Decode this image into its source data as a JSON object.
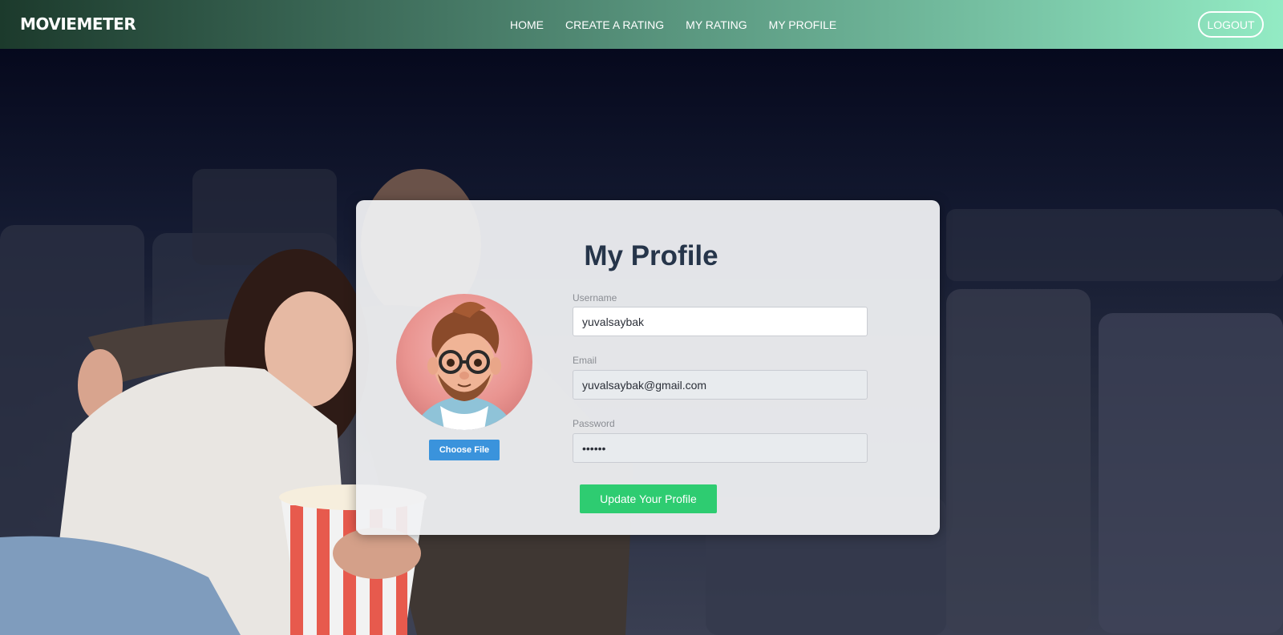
{
  "nav": {
    "brand": "MOVIEMETER",
    "links": [
      "HOME",
      "CREATE A RATING",
      "MY RATING",
      "MY PROFILE"
    ],
    "logout_label": "LOGOUT"
  },
  "profile": {
    "title": "My Profile",
    "choose_file_label": "Choose File",
    "username": {
      "label": "Username",
      "value": "yuvalsaybak"
    },
    "email": {
      "label": "Email",
      "value": "yuvalsaybak@gmail.com"
    },
    "password": {
      "label": "Password",
      "value": "••••••"
    },
    "update_label": "Update Your Profile"
  },
  "colors": {
    "accent_green": "#2ecc71",
    "choose_file_blue": "#3a93dc",
    "title_navy": "#26354a"
  }
}
